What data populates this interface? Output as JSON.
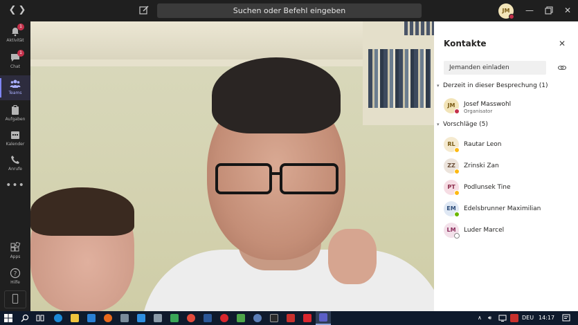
{
  "titlebar": {
    "search_placeholder": "Suchen oder Befehl eingeben",
    "user_initials": "JM"
  },
  "rail": {
    "items": [
      {
        "label": "Aktivität",
        "badge": "1"
      },
      {
        "label": "Chat",
        "badge": "1"
      },
      {
        "label": "Teams",
        "badge": ""
      },
      {
        "label": "Aufgaben",
        "badge": ""
      },
      {
        "label": "Kalender",
        "badge": ""
      },
      {
        "label": "Anrufe",
        "badge": ""
      }
    ],
    "more": "•••",
    "apps": "Apps",
    "help": "Hilfe"
  },
  "panel": {
    "title": "Kontakte",
    "invite_placeholder": "Jemanden einladen",
    "section_current": "Derzeit in dieser Besprechung (1)",
    "section_suggestions": "Vorschläge (5)",
    "current": [
      {
        "initials": "JM",
        "name": "Josef Masswohl",
        "role": "Organisator"
      }
    ],
    "suggestions": [
      {
        "initials": "RL",
        "name": "Rautar Leon"
      },
      {
        "initials": "ZZ",
        "name": "Zrinski Zan"
      },
      {
        "initials": "PT",
        "name": "Podlunsek Tine"
      },
      {
        "initials": "EM",
        "name": "Edelsbrunner Maximilian"
      },
      {
        "initials": "LM",
        "name": "Luder Marcel"
      }
    ]
  },
  "taskbar": {
    "language": "DEU",
    "time": "14:17"
  },
  "colors": {
    "accent": "#7f85f5",
    "busy": "#c4314b",
    "away": "#fdb913",
    "available": "#6bb700"
  }
}
